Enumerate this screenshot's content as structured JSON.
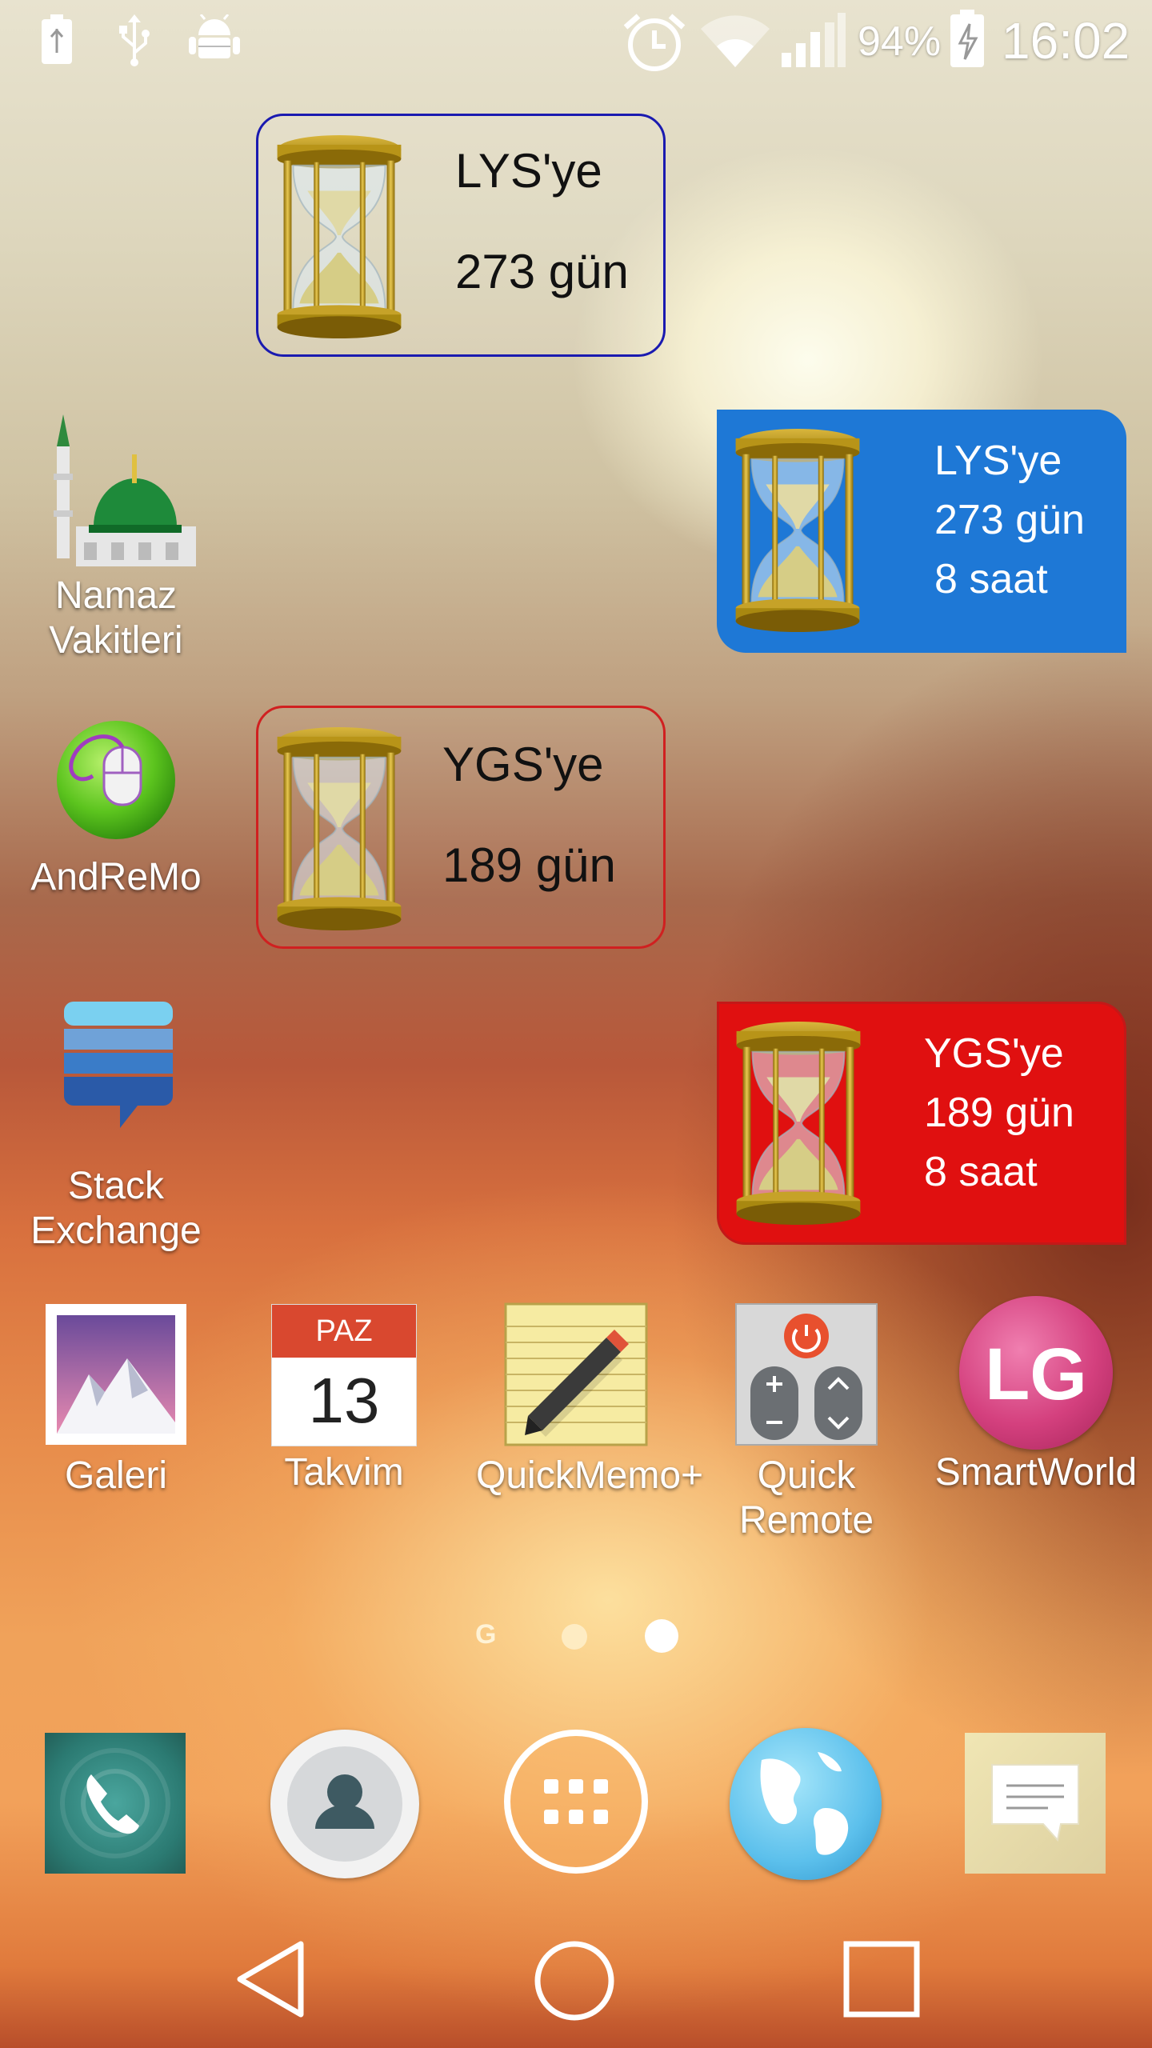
{
  "status_bar": {
    "battery_percent": "94%",
    "time": "16:02",
    "left_icons": [
      "battery-charging-icon",
      "usb-icon",
      "android-debug-icon"
    ],
    "right_icons": [
      "alarm-icon",
      "wifi-icon",
      "signal-icon",
      "battery-icon"
    ]
  },
  "widgets": {
    "lys_small": {
      "title": "LYS'ye",
      "days": "273 gün"
    },
    "lys_blue": {
      "title": "LYS'ye",
      "days": "273 gün",
      "hours": "8 saat"
    },
    "ygs_small": {
      "title": "YGS'ye",
      "days": "189 gün"
    },
    "ygs_red": {
      "title": "YGS'ye",
      "days": "189 gün",
      "hours": "8 saat"
    }
  },
  "apps": {
    "namaz": {
      "label_line1": "Namaz",
      "label_line2": "Vakitleri"
    },
    "andremo": {
      "label": "AndReMo"
    },
    "stack": {
      "label_line1": "Stack",
      "label_line2": "Exchange"
    },
    "galeri": {
      "label": "Galeri"
    },
    "takvim": {
      "label": "Takvim",
      "day_abbr": "PAZ",
      "day_num": "13"
    },
    "quickmemo": {
      "label": "QuickMemo+"
    },
    "quickremote": {
      "label_line1": "Quick",
      "label_line2": "Remote"
    },
    "smartworld": {
      "label": "SmartWorld",
      "logo_text": "LG"
    }
  },
  "page_indicator": {
    "g_label": "G",
    "current_page": 3,
    "total_pages": 3
  },
  "dock": [
    "phone-icon",
    "contacts-icon",
    "app-drawer-icon",
    "browser-globe-icon",
    "messaging-icon"
  ],
  "nav_bar": [
    "back-icon",
    "home-icon",
    "recents-icon"
  ],
  "colors": {
    "widget_blue": "#1e78d6",
    "widget_red": "#e01010",
    "widget_blue_border": "#1a1ab0",
    "widget_red_border": "#d02020"
  }
}
